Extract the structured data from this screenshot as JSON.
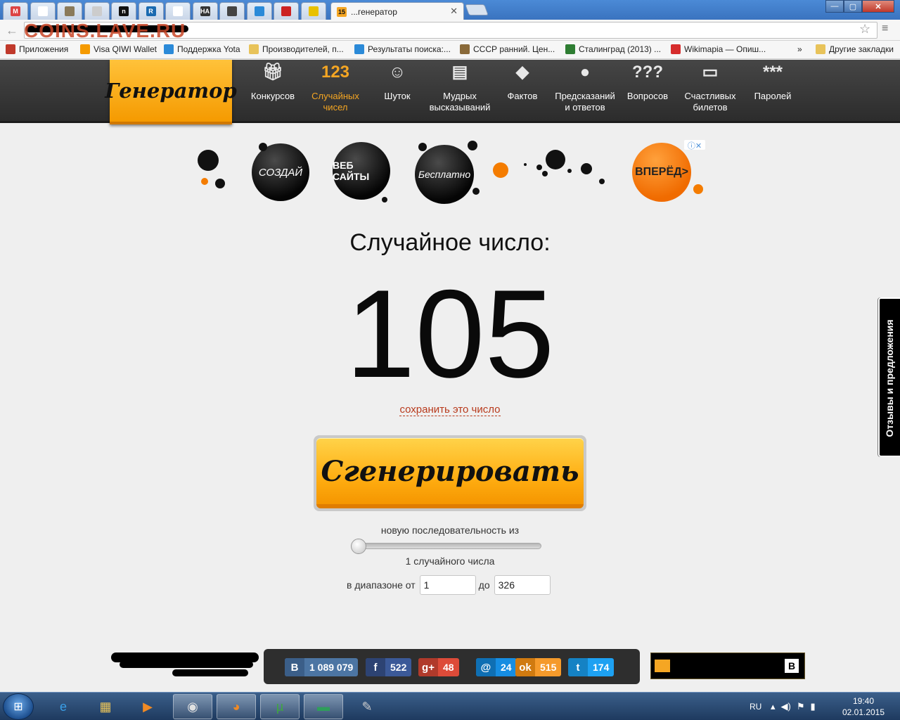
{
  "browser": {
    "tabs": [
      {
        "icon": "gmail-icon",
        "glyph": "M",
        "color": "#d44"
      },
      {
        "icon": "page-icon",
        "glyph": "",
        "color": "#fff"
      },
      {
        "icon": "coin-icon",
        "glyph": "",
        "color": "#8a7a5a"
      },
      {
        "icon": "loading-icon",
        "glyph": "",
        "color": "#ccc"
      },
      {
        "icon": "n-icon",
        "glyph": "n",
        "color": "#111"
      },
      {
        "icon": "r-icon",
        "glyph": "R",
        "color": "#1a6ab0"
      },
      {
        "icon": "page-icon",
        "glyph": "",
        "color": "#fff"
      },
      {
        "icon": "na-icon",
        "glyph": "НА",
        "color": "#333"
      },
      {
        "icon": "swirl-icon",
        "glyph": "",
        "color": "#444"
      },
      {
        "icon": "circle-icon",
        "glyph": "",
        "color": "#2a8ad8"
      },
      {
        "icon": "hammer-sickle-icon",
        "glyph": "",
        "color": "#c22"
      },
      {
        "icon": "smiley-icon",
        "glyph": "",
        "color": "#e9c100"
      }
    ],
    "active_tab": {
      "title": "...генератор",
      "icon_text": "15"
    },
    "watermark": "COINS.LAVE.RU",
    "bookmarks": [
      {
        "label": "Приложения",
        "icon": "apps-icon"
      },
      {
        "label": "Visa QIWI Wallet",
        "icon": "qiwi-icon"
      },
      {
        "label": "Поддержка Yota",
        "icon": "yota-icon"
      },
      {
        "label": "Производителей, п...",
        "icon": "folder-icon"
      },
      {
        "label": "Результаты поиска:...",
        "icon": "yota-icon"
      },
      {
        "label": "СССР ранний. Цен...",
        "icon": "coin-icon"
      },
      {
        "label": "Сталинград (2013) ...",
        "icon": "shield-icon"
      },
      {
        "label": "Wikimapia — Опиш...",
        "icon": "wikimapia-icon"
      }
    ],
    "overflow": "»",
    "other_bookmarks": "Другие закладки"
  },
  "site": {
    "logo": "Генератор",
    "nav": [
      {
        "icon": "gift-icon",
        "glyph": "🎁︎",
        "label1": "Конкурсов",
        "label2": ""
      },
      {
        "icon": "numbers-icon",
        "glyph": "123",
        "label1": "Случайных",
        "label2": "чисел"
      },
      {
        "icon": "smiley-icon",
        "glyph": "☺︎",
        "label1": "Шуток",
        "label2": ""
      },
      {
        "icon": "quote-icon",
        "glyph": "▤",
        "label1": "Мудрых",
        "label2": "высказываний"
      },
      {
        "icon": "warning-icon",
        "glyph": "◆",
        "label1": "Фактов",
        "label2": ""
      },
      {
        "icon": "eight-ball-icon",
        "glyph": "●",
        "label1": "Предсказаний",
        "label2": "и ответов"
      },
      {
        "icon": "question-icon",
        "glyph": "???",
        "label1": "Вопросов",
        "label2": ""
      },
      {
        "icon": "ticket-icon",
        "glyph": "▭",
        "label1": "Счастливых",
        "label2": "билетов"
      },
      {
        "icon": "password-icon",
        "glyph": "***",
        "label1": "Паролей",
        "label2": ""
      }
    ]
  },
  "ad": {
    "ball1": "СОЗДАЙ",
    "ball2": "ВЕБ САЙТЫ",
    "ball3": "Бесплатно",
    "cta": "ВПЕРЁД>",
    "adchoices": "ⓘ✕"
  },
  "main": {
    "heading": "Случайное число:",
    "number": "105",
    "save_link": "сохранить это число",
    "generate_button": "Сгенерировать",
    "sequence_label": "новую последовательность из",
    "slider_value": 1,
    "count_label": "1 случайного числа",
    "range_from_label": "в диапазоне от",
    "range_from": "1",
    "range_to_label": "до",
    "range_to": "326"
  },
  "feedback_tab": "Отзывы и предложения",
  "social": [
    {
      "network": "vk",
      "icon": "vk-icon",
      "glyph": "B",
      "count": "1 089 079",
      "color": "#4c75a3",
      "dark": "#3b5e88"
    },
    {
      "network": "facebook",
      "icon": "facebook-icon",
      "glyph": "f",
      "count": "522",
      "color": "#3b5998",
      "dark": "#2d4373"
    },
    {
      "network": "googleplus",
      "icon": "googleplus-icon",
      "glyph": "g+",
      "count": "48",
      "color": "#dd4b39",
      "dark": "#b03a2b"
    },
    {
      "network": "mailru",
      "icon": "mailru-icon",
      "glyph": "@",
      "count": "24",
      "color": "#168de2",
      "dark": "#0f6fb3"
    },
    {
      "network": "odnoklassniki",
      "icon": "odnoklassniki-icon",
      "glyph": "ok",
      "count": "515",
      "color": "#f59a2b",
      "dark": "#d07a10"
    },
    {
      "network": "twitter",
      "icon": "twitter-icon",
      "glyph": "t",
      "count": "174",
      "color": "#1da1f2",
      "dark": "#1582c4"
    }
  ],
  "footer_box_vk": "B",
  "taskbar": {
    "lang": "RU",
    "time": "19:40",
    "date": "02.01.2015",
    "apps": [
      {
        "icon": "ie-icon",
        "glyph": "e",
        "color": "#3aa0e8"
      },
      {
        "icon": "explorer-icon",
        "glyph": "▦",
        "color": "#e8c35a"
      },
      {
        "icon": "media-player-icon",
        "glyph": "▶",
        "color": "#f08a24"
      },
      {
        "icon": "chrome-icon",
        "glyph": "◉",
        "color": "#e0e0e0"
      },
      {
        "icon": "firefox-icon",
        "glyph": "◕",
        "color": "#f08a24"
      },
      {
        "icon": "utorrent-icon",
        "glyph": "µ",
        "color": "#3ea83e"
      },
      {
        "icon": "terminal-icon",
        "glyph": "▬",
        "color": "#2e9e5a"
      },
      {
        "icon": "paint-icon",
        "glyph": "✎",
        "color": "#d0d0d0"
      }
    ]
  }
}
